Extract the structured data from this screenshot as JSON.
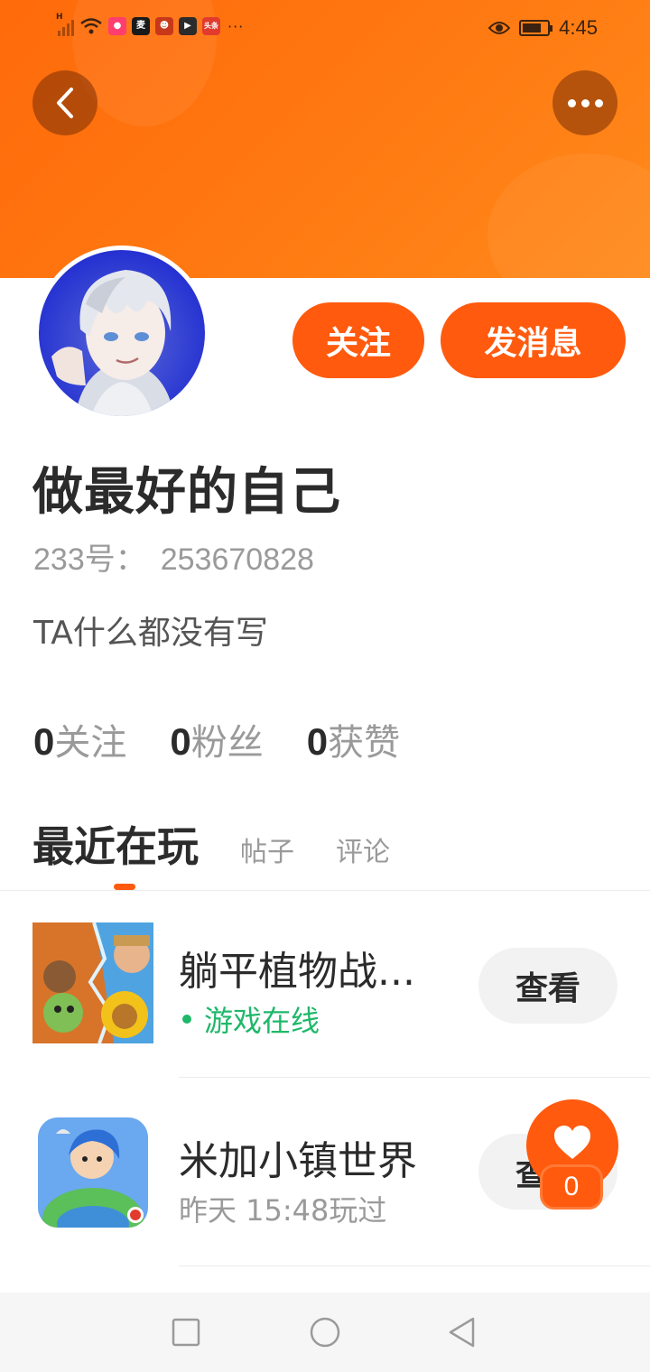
{
  "status_bar": {
    "time": "4:45",
    "app_icons": [
      {
        "name": "app-icon-1",
        "color": "#ff3d6e"
      },
      {
        "name": "app-icon-2",
        "color": "#1a1a1a"
      },
      {
        "name": "app-icon-3",
        "color": "#c7381a"
      },
      {
        "name": "app-icon-4",
        "color": "#2b2b2b"
      },
      {
        "name": "app-icon-5",
        "color": "#e23b2e"
      }
    ],
    "toutiao_label": "头条",
    "overflow": "···"
  },
  "profile": {
    "follow_label": "关注",
    "message_label": "发消息",
    "username": "做最好的自己",
    "id_prefix": "233号：",
    "id_value": "253670828",
    "bio": "TA什么都没有写"
  },
  "stats": [
    {
      "num": "0",
      "label": "关注"
    },
    {
      "num": "0",
      "label": "粉丝"
    },
    {
      "num": "0",
      "label": "获赞"
    }
  ],
  "tabs": {
    "active": "最近在玩",
    "posts": "帖子",
    "comments": "评论"
  },
  "games": [
    {
      "title": "躺平植物战...",
      "status": "游戏在线",
      "button": "查看"
    },
    {
      "title": "米加小镇世界",
      "status": "昨天 15:48玩过",
      "button": "查看"
    }
  ],
  "like": {
    "count": "0"
  },
  "colors": {
    "accent": "#ff5a0e",
    "online": "#1fb86a",
    "banner": "#ff7a12"
  }
}
